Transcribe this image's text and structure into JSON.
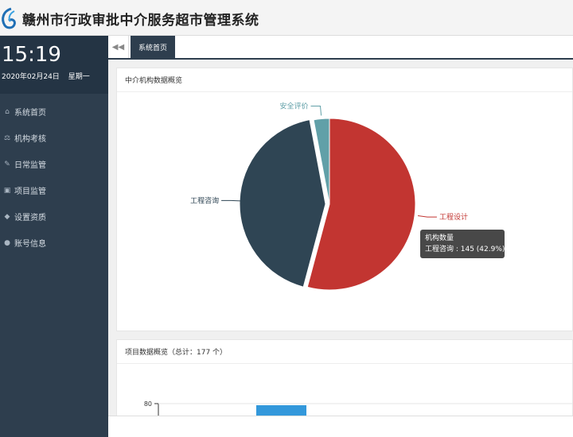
{
  "app": {
    "title": "赣州市行政审批中介服务超市管理系统"
  },
  "clock": {
    "time": "15:19",
    "date": "2020年02月24日",
    "weekday": "星期一"
  },
  "sidebar": {
    "items": [
      {
        "label": "系统首页",
        "icon": "home-icon",
        "glyph": "⌂"
      },
      {
        "label": "机构考核",
        "icon": "scale-icon",
        "glyph": "⚖"
      },
      {
        "label": "日常监管",
        "icon": "edit-icon",
        "glyph": "✎"
      },
      {
        "label": "项目监管",
        "icon": "picture-icon",
        "glyph": "▣"
      },
      {
        "label": "设置资质",
        "icon": "tag-icon",
        "glyph": "◆"
      },
      {
        "label": "账号信息",
        "icon": "user-icon",
        "glyph": "●"
      }
    ]
  },
  "tabs": {
    "back_icon": "double-left-arrow-icon",
    "active": "系统首页"
  },
  "panel1": {
    "title": "中介机构数据概览"
  },
  "panel2": {
    "title": "项目数据概览（总计：177 个）"
  },
  "chart_data": [
    {
      "type": "pie",
      "series_name": "机构数量",
      "slices": [
        {
          "label": "工程设计",
          "value": 183,
          "color": "#c23531"
        },
        {
          "label": "工程咨询",
          "value": 145,
          "percent": "42.9%",
          "color": "#2f4554"
        },
        {
          "label": "安全评价",
          "value": 10,
          "color": "#61a0a8"
        }
      ],
      "tooltip": {
        "title": "机构数量",
        "text": "工程咨询 : 145 (42.9%)"
      }
    },
    {
      "type": "bar",
      "y_tick_visible": "80",
      "bar_color": "#3398db"
    }
  ]
}
